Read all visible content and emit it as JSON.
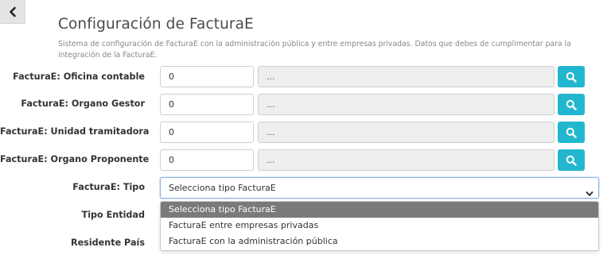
{
  "header": {
    "title": "Configuración de FacturaE",
    "description": "Sistema de configuración de FacturaE con la administración pública y entre empresas privadas. Datos que debes de cumplimentar para la integración de la FacturaE."
  },
  "fields": [
    {
      "label": "FacturaE: Oficina contable",
      "code": "0",
      "description": "..."
    },
    {
      "label": "FacturaE: Organo Gestor",
      "code": "0",
      "description": "..."
    },
    {
      "label": "FacturaE: Unidad tramitadora",
      "code": "0",
      "description": "..."
    },
    {
      "label": "FacturaE: Organo Proponente",
      "code": "0",
      "description": "..."
    }
  ],
  "tipo": {
    "label": "FacturaE: Tipo",
    "selected": "Selecciona tipo FacturaE",
    "options": [
      "Selecciona tipo FacturaE",
      "FacturaE entre empresas privadas",
      "FacturaE con la administración pública"
    ]
  },
  "partial_labels": {
    "tipo_entidad": "Tipo Entidad",
    "residente_pais": "Residente País"
  },
  "colors": {
    "search_button": "#22b7cf",
    "selected_option": "#7a7a7a"
  },
  "icons": {
    "back": "chevron-left-icon",
    "search": "search-icon",
    "select_arrow": "chevron-down-icon"
  }
}
